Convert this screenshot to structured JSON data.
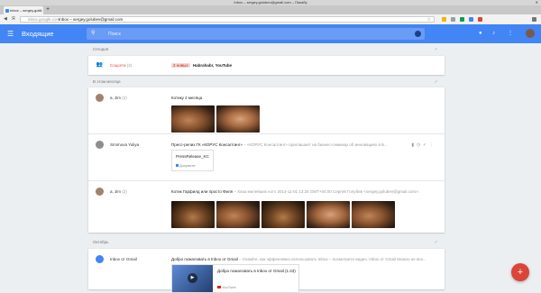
{
  "browser": {
    "window_title": "Inbox – sergey.golubev@gmail.com – Пикабу",
    "tab_label": "Inbox – sergey.golu",
    "tab_close": "✕",
    "new_tab": "+",
    "host": "inbox.google.com",
    "page_title": "Inbox – sergey.golubev@gmail.com",
    "ext_colors": [
      "#f4b400",
      "#9e9e9e",
      "#0f9d58",
      "#4285f4",
      "#db4437",
      "#757575"
    ]
  },
  "appbar": {
    "title": "Входящие",
    "search_placeholder": "Поиск",
    "color": "#4285f4"
  },
  "sections": {
    "today": "Сегодня",
    "this_month": "В этом месяце",
    "october": "Октябрь"
  },
  "bundle": {
    "label": "Соцсети",
    "count": "(2)",
    "badge": "2 новых",
    "summary": "Habrahabr, YouTube"
  },
  "emails": [
    {
      "sender": "a, Jim",
      "count": "(2)",
      "subject": "Котику 2 месяца",
      "snippet": ""
    },
    {
      "sender": "Smirnova Yuliya",
      "count": "",
      "subject": "Пресс-релиз ГК «КОРУС Консалтинг»",
      "snippet": " – «КОРУС Консалтинг» приглашает на бизнес-семинар об инновациях в Б...",
      "attachment_name": "PressRelease_KC",
      "attachment_type": "Документ"
    },
    {
      "sender": "a, Jim",
      "count": "(2)",
      "subject": "Котик Гарфилд или просто Филя",
      "snippet": " – Хаха милейших котэ 2014-11-01 13:25 GMT+04:00 Сергей Голубев <sergey.golubev@gmail.com>:"
    },
    {
      "sender": "Inbox от Gmail",
      "count": "",
      "subject": "Добро пожаловать в Inbox от Gmail",
      "snippet": " – Узнайте, как эффективно использовать Inbox – посмотрите видео. Inbox от Gmail Можно не все...",
      "video_title": "Добро пожаловать в Inbox от Gmail (1:43)",
      "video_source": "YouTube"
    }
  ],
  "icons": {
    "menu": "☰",
    "search": "⚲",
    "sweep": "✓",
    "pin": "📌",
    "reminder": "⏰",
    "done": "✓",
    "more": "⋮",
    "fab": "+"
  }
}
